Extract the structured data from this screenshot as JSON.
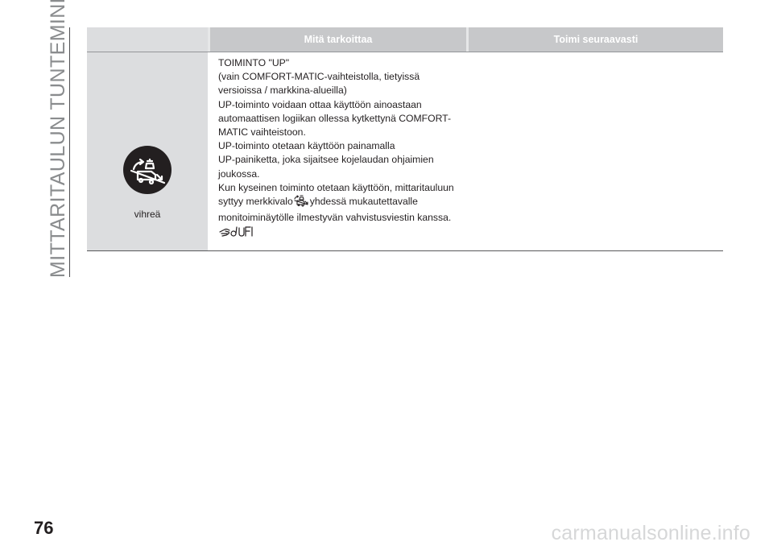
{
  "side_title": "MITTARITAULUN TUNTEMINEN",
  "table": {
    "headers": [
      "",
      "Mitä tarkoittaa",
      "Toimi seuraavasti"
    ],
    "row": {
      "color_label": "vihreä",
      "lines": [
        "TOIMINTO \"UP\"",
        "(vain COMFORT-MATIC-vaihteistolla, tietyissä",
        "versioissa / markkina-alueilla)",
        "UP-toiminto voidaan ottaa käyttöön ainoastaan",
        "automaattisen logiikan ollessa kytkettynä COMFORT-",
        "MATIC vaihteistoon.",
        "UP-toiminto otetaan käyttöön painamalla",
        "UP-painiketta, joka sijaitsee kojelaudan ohjaimien",
        "joukossa.",
        "Kun kyseinen toiminto otetaan käyttöön, mittaritauluun"
      ],
      "line_icon_before": "syttyy merkkivalo",
      "line_icon_after": "yhdessä mukautettavalle",
      "last_line": "monitoiminäytölle ilmestyvän vahvistusviestin kanssa.",
      "indicator_icon": "truck-uphill-icon",
      "reference_icon": "hand-book-reference-icon",
      "action": ""
    }
  },
  "page_number": "76",
  "watermark": "carmanualsonline.info"
}
